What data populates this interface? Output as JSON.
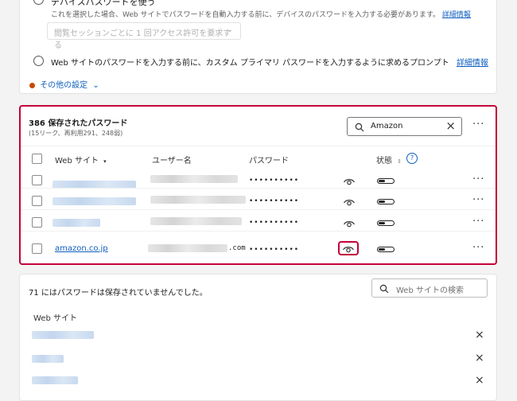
{
  "colors": {
    "accent": "#0f5fbf",
    "highlight": "#c4003a",
    "warning": "#c84a00"
  },
  "settings": {
    "device_password_label": "デバイスパスワードを使う",
    "device_password_desc": "これを選択した場合、Web サイトでパスワードを自動入力する前に、デバイスのパスワードを入力する必要があります。",
    "details_link": "詳細情報",
    "frequency_dropdown": "閲覧セッションごとに 1 回アクセス許可を要求する",
    "custom_password_label": "Web サイトのパスワードを入力する前に、カスタム プライマリ パスワードを入力するように求めるプロンプト",
    "details_link2": "詳細情報",
    "more_settings": "その他の設定"
  },
  "saved": {
    "title": "386 保存されたパスワード",
    "subtitle": "(15リーク、再利用291、248弱)",
    "search_value": "Amazon",
    "more": "···",
    "columns": {
      "website": "Web サイト",
      "username": "ユーザー名",
      "password": "パスワード",
      "status": "状態"
    },
    "rows": [
      {
        "site": "",
        "user": "",
        "password": "••••••••••",
        "more": "···"
      },
      {
        "site": "",
        "user": "",
        "password": "••••••••••",
        "more": "···"
      },
      {
        "site": "",
        "user": "",
        "password": "••••••••••",
        "more": "···"
      },
      {
        "site": "amazon.co.jp",
        "user": ".com",
        "password": "••••••••••",
        "more": "···"
      }
    ]
  },
  "never_saved": {
    "title": "71 にはパスワードは保存されていませんでした。",
    "search_placeholder": "Web サイトの検索",
    "column": "Web サイト",
    "close": "×"
  }
}
